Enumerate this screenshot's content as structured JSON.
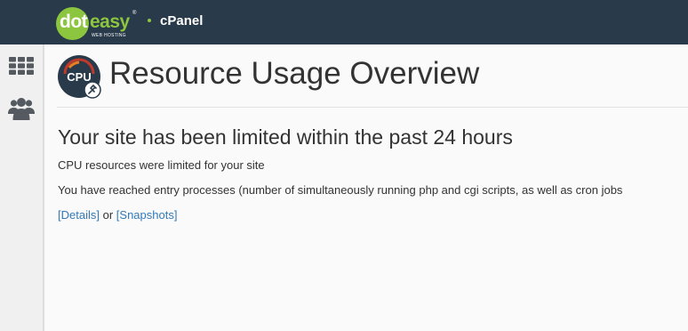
{
  "topbar": {
    "logo": {
      "part1": "dot",
      "part2": "easy",
      "tagline": "WEB HOSTING",
      "mark": "®"
    },
    "product": "cPanel"
  },
  "sidebar": {
    "items": [
      {
        "icon": "grid-icon"
      },
      {
        "icon": "users-icon"
      }
    ]
  },
  "main": {
    "icon": {
      "label": "CPU"
    },
    "title": "Resource Usage Overview",
    "alert": {
      "heading": "Your site has been limited within the past 24 hours",
      "line1": "CPU resources were limited for your site",
      "line2": "You have reached entry processes (number of simultaneously running php and cgi scripts, as well as cron jobs",
      "details_label": "[Details]",
      "or_text": "or",
      "snapshots_label": "[Snapshots]"
    }
  },
  "colors": {
    "topbar": "#293a4a",
    "brand_green": "#8cc63f",
    "link": "#337ab7",
    "text": "#333333"
  }
}
